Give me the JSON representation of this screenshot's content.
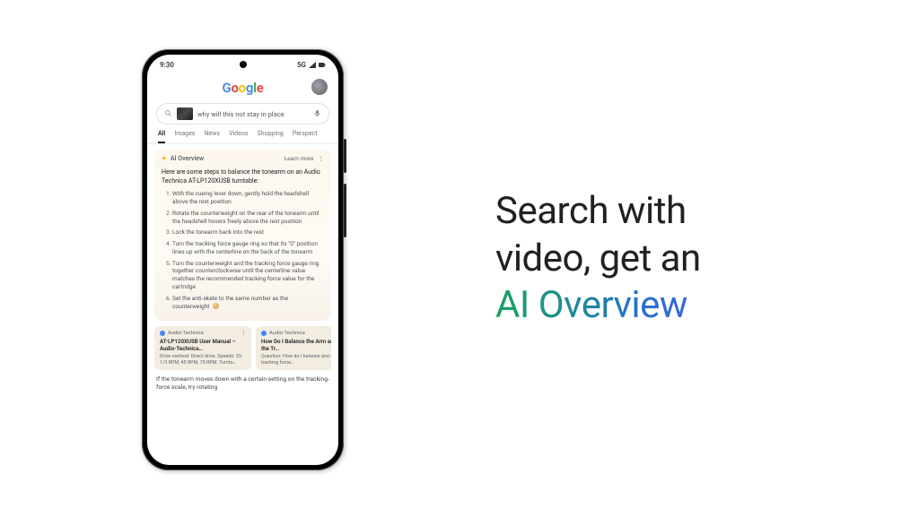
{
  "statusbar": {
    "time": "9:30",
    "network": "5G"
  },
  "logo_letters": "Google",
  "search": {
    "query": "why will this not stay in place"
  },
  "tabs": [
    "All",
    "Images",
    "News",
    "Videos",
    "Shopping",
    "Perspect"
  ],
  "ai": {
    "label": "AI Overview",
    "learn_more": "Learn more",
    "intro": "Here are some steps to balance the tonearm on an Audio Technica AT-LP120XUSB turntable:",
    "steps": [
      "With the cueing lever down, gently hold the headshell above the rest position",
      "Rotate the counterweight on the rear of the tonearm until the headshell hovers freely above the rest position",
      "Lock the tonearm back into the rest",
      "Turn the tracking force gauge ring so that its \"0\" position lines up with the centerline on the back of the tonearm",
      "Turn the counterweight and the tracking force gauge ring together counterclockwise until the centerline value matches the recommended tracking force value for the cartridge",
      "Set the anti-skate to the same number as the counterweight"
    ]
  },
  "cards": [
    {
      "source": "Audio-Technica",
      "title": "AT-LP120XUSB User Manual – Audio-Technica…",
      "desc": "Drive method: Direct drive. Speeds: 33-1/3 RPM, 45 RPM, 78 RPM. Turnta…"
    },
    {
      "source": "Audio-Technica",
      "title": "How Do I Balance the Arm and Set the Tr…",
      "desc": "Question: How do I balance and set the tracking force…"
    }
  ],
  "followup": "If the tonearm moves down with a certain setting on the tracking-force scale, try rotating",
  "tagline": {
    "line1": "Search with",
    "line2": "video, get an",
    "line3": "AI Overview"
  }
}
